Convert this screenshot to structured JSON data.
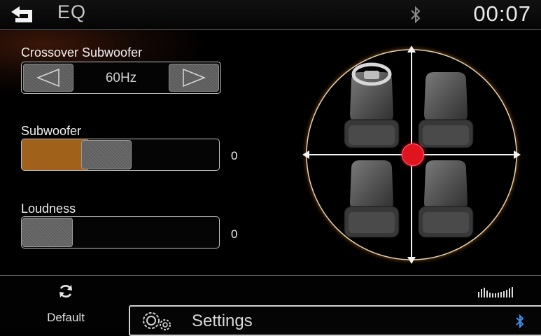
{
  "header": {
    "title": "EQ",
    "time": "00:07",
    "back_icon": "back-arrow-icon",
    "bluetooth_icon": "bluetooth-icon"
  },
  "crossover": {
    "label": "Crossover Subwoofer",
    "value": "60Hz"
  },
  "subwoofer": {
    "label": "Subwoofer",
    "value": "0",
    "level_percent": 40
  },
  "loudness": {
    "label": "Loudness",
    "value": "0",
    "level_percent": 0
  },
  "fader": {
    "balance": 0,
    "fade": 0
  },
  "footer": {
    "default_label": "Default",
    "settings_label": "Settings"
  },
  "colors": {
    "accent_fill": "#a0621a",
    "fader_dot": "#e0141e",
    "glow": "#c87818"
  }
}
